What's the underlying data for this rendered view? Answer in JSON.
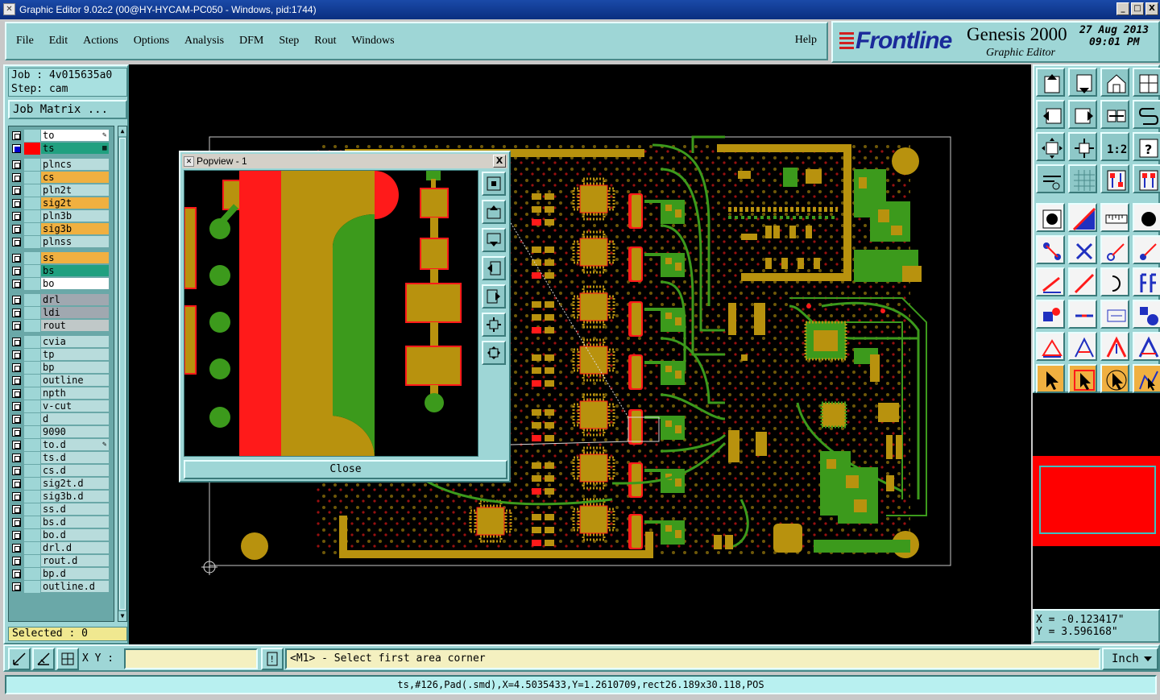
{
  "window": {
    "title": "Graphic Editor 9.02c2 (00@HY-HYCAM-PC050 - Windows, pid:1744)",
    "minimize": "_",
    "maximize": "□",
    "close": "X"
  },
  "menu": {
    "items": [
      "File",
      "Edit",
      "Actions",
      "Options",
      "Analysis",
      "DFM",
      "Step",
      "Rout",
      "Windows"
    ],
    "help": "Help"
  },
  "brand": {
    "logo": "Frontline",
    "product": "Genesis 2000",
    "subtitle": "Graphic Editor",
    "date": "27 Aug 2013",
    "time": "09:01 PM"
  },
  "job": {
    "job_line": "Job : 4v015635a0",
    "step_line": "Step: cam",
    "matrix_button": "Job Matrix ...",
    "selected": "Selected : 0"
  },
  "layers": [
    {
      "name": "to",
      "swatch": "#9ed6d6",
      "bg": "#ffffff",
      "mark": "✎"
    },
    {
      "name": "ts",
      "swatch": "#ff0000",
      "bg": "#20a080",
      "selected": true,
      "mark": "▦"
    },
    {
      "name": "plncs",
      "swatch": "#9ed6d6",
      "bg": "#b8dcdc"
    },
    {
      "name": "cs",
      "swatch": "#9ed6d6",
      "bg": "#f0b040"
    },
    {
      "name": "pln2t",
      "swatch": "#9ed6d6",
      "bg": "#b8dcdc"
    },
    {
      "name": "sig2t",
      "swatch": "#9ed6d6",
      "bg": "#f0b040"
    },
    {
      "name": "pln3b",
      "swatch": "#9ed6d6",
      "bg": "#b8dcdc"
    },
    {
      "name": "sig3b",
      "swatch": "#9ed6d6",
      "bg": "#f0b040"
    },
    {
      "name": "plnss",
      "swatch": "#9ed6d6",
      "bg": "#b8dcdc"
    },
    {
      "name": "ss",
      "swatch": "#9ed6d6",
      "bg": "#f0b040"
    },
    {
      "name": "bs",
      "swatch": "#9ed6d6",
      "bg": "#20a080"
    },
    {
      "name": "bo",
      "swatch": "#9ed6d6",
      "bg": "#ffffff"
    },
    {
      "name": "drl",
      "swatch": "#9ed6d6",
      "bg": "#a0a8b0"
    },
    {
      "name": "ldi",
      "swatch": "#9ed6d6",
      "bg": "#a0a8b0"
    },
    {
      "name": "rout",
      "swatch": "#9ed6d6",
      "bg": "#c0c8c8"
    },
    {
      "name": "cvia",
      "swatch": "#9ed6d6",
      "bg": "#b8dcdc"
    },
    {
      "name": "tp",
      "swatch": "#9ed6d6",
      "bg": "#b8dcdc"
    },
    {
      "name": "bp",
      "swatch": "#9ed6d6",
      "bg": "#b8dcdc"
    },
    {
      "name": "outline",
      "swatch": "#9ed6d6",
      "bg": "#b8dcdc"
    },
    {
      "name": "npth",
      "swatch": "#9ed6d6",
      "bg": "#b8dcdc"
    },
    {
      "name": "v-cut",
      "swatch": "#9ed6d6",
      "bg": "#b8dcdc"
    },
    {
      "name": "d",
      "swatch": "#9ed6d6",
      "bg": "#b8dcdc"
    },
    {
      "name": "9090",
      "swatch": "#9ed6d6",
      "bg": "#b8dcdc"
    },
    {
      "name": "to.d",
      "swatch": "#9ed6d6",
      "bg": "#b8dcdc",
      "mark": "✎"
    },
    {
      "name": "ts.d",
      "swatch": "#9ed6d6",
      "bg": "#b8dcdc"
    },
    {
      "name": "cs.d",
      "swatch": "#9ed6d6",
      "bg": "#b8dcdc"
    },
    {
      "name": "sig2t.d",
      "swatch": "#9ed6d6",
      "bg": "#b8dcdc"
    },
    {
      "name": "sig3b.d",
      "swatch": "#9ed6d6",
      "bg": "#b8dcdc"
    },
    {
      "name": "ss.d",
      "swatch": "#9ed6d6",
      "bg": "#b8dcdc"
    },
    {
      "name": "bs.d",
      "swatch": "#9ed6d6",
      "bg": "#b8dcdc"
    },
    {
      "name": "bo.d",
      "swatch": "#9ed6d6",
      "bg": "#b8dcdc"
    },
    {
      "name": "drl.d",
      "swatch": "#9ed6d6",
      "bg": "#b8dcdc"
    },
    {
      "name": "rout.d",
      "swatch": "#9ed6d6",
      "bg": "#b8dcdc"
    },
    {
      "name": "bp.d",
      "swatch": "#9ed6d6",
      "bg": "#b8dcdc"
    },
    {
      "name": "outline.d",
      "swatch": "#9ed6d6",
      "bg": "#b8dcdc"
    }
  ],
  "toolbar_icons": [
    "open-job-icon",
    "save-icon",
    "home-icon",
    "window-icon",
    "prev-layer-icon",
    "next-layer-icon",
    "swap-icon",
    "scripts-icon",
    "zoom-fit-icon",
    "zoom-center-icon",
    "one-to-one-icon",
    "help-icon",
    "tools-icon",
    "grid-icon",
    "layers-red-icon",
    "layers-red2-icon",
    "pad-icon",
    "measure-icon",
    "ruler-icon",
    "dot-icon",
    "connect-icon",
    "cross-icon",
    "line-dot-icon",
    "line-dot2-icon",
    "line-angle-icon",
    "line-diag-icon",
    "arc-icon",
    "flip-icon",
    "surface-icon",
    "line-h-icon",
    "dim-icon",
    "shapes-icon",
    "triangle-red-icon",
    "triangle-icon",
    "triangle-arrow-icon",
    "triangle-blue-icon",
    "pointer-icon",
    "select-icon",
    "select-area-icon",
    "route-icon"
  ],
  "coordinates": {
    "x": "X = -0.123417\"",
    "y": "Y = 3.596168\""
  },
  "bottom": {
    "xy_label": "X Y :",
    "xy_value": "",
    "prompt_icon": "!",
    "prompt": "<M1> - Select first area corner",
    "units": "Inch",
    "status": "ts,#126,Pad(.smd),X=4.5035433,Y=1.2610709,rect26.189x30.118,POS"
  },
  "popview": {
    "title": "Popview - 1",
    "close_x": "X",
    "close_button": "Close"
  },
  "colors": {
    "panel": "#9ed6d6",
    "copper_gold": "#b8920e",
    "copper_green": "#3c9a1c",
    "copper_red": "#ff1a1a",
    "canvas": "#000000"
  }
}
